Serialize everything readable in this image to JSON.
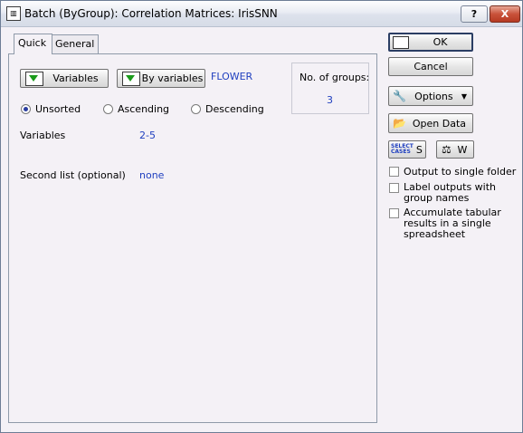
{
  "window": {
    "title": "Batch (ByGroup): Correlation Matrices: IrisSNN",
    "help_label": "?",
    "close_label": "X"
  },
  "tabs": [
    {
      "label": "Quick"
    },
    {
      "label": "General"
    }
  ],
  "quick": {
    "variables_button": "Variables",
    "by_variables_button": "By variables",
    "by_variable_value": "FLOWER",
    "groups_label": "No. of groups:",
    "groups_value": "3",
    "sort_options": [
      "Unsorted",
      "Ascending",
      "Descending"
    ],
    "sort_selected": "Unsorted",
    "variables_label": "Variables",
    "variables_value": "2-5",
    "second_list_label": "Second list (optional)",
    "second_list_value": "none"
  },
  "side": {
    "ok": "OK",
    "cancel": "Cancel",
    "options": "Options",
    "open_data": "Open Data",
    "select_cases_top": "SELECT",
    "select_cases_bottom": "CASES",
    "select_cases_key": "S",
    "weight_key": "W",
    "checkboxes": [
      {
        "label": "Output to single folder",
        "checked": false
      },
      {
        "label": "Label outputs with group names",
        "checked": false
      },
      {
        "label": "Accumulate tabular results in a single spreadsheet",
        "checked": false
      }
    ]
  }
}
